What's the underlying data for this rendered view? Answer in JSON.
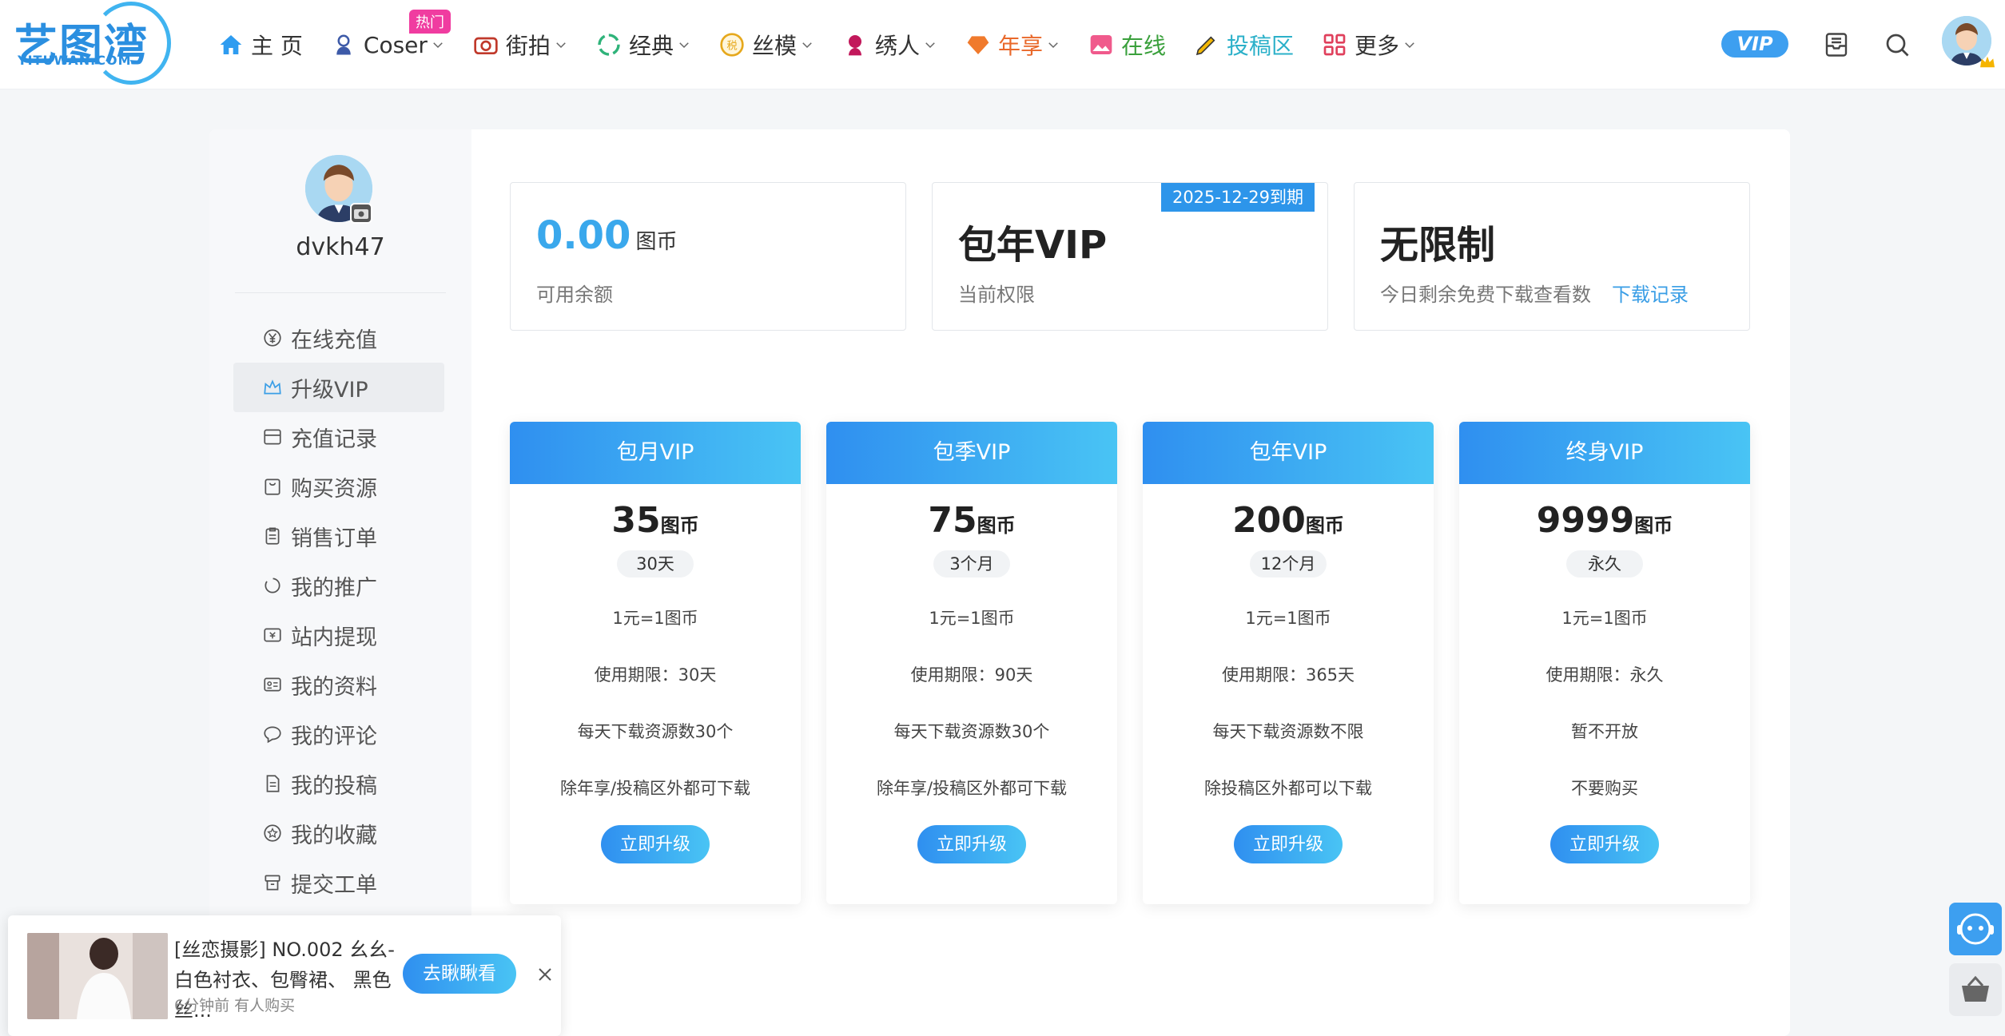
{
  "logo": {
    "text": "艺图湾",
    "sub": "YITUWAN.COM"
  },
  "nav": {
    "items": [
      {
        "label": "主 页",
        "icon": "home-icon"
      },
      {
        "label": "Coser",
        "icon": "coser-icon",
        "dropdown": true
      },
      {
        "label": "街拍",
        "icon": "camera-icon",
        "dropdown": true
      },
      {
        "label": "经典",
        "icon": "recycle-icon",
        "dropdown": true
      },
      {
        "label": "丝模",
        "icon": "stamp-icon",
        "dropdown": true
      },
      {
        "label": "绣人",
        "icon": "woman-icon",
        "dropdown": true
      },
      {
        "label": "年享",
        "icon": "diamond-icon",
        "dropdown": true
      },
      {
        "label": "在线",
        "icon": "image-icon"
      },
      {
        "label": "投稿区",
        "icon": "pen-icon"
      },
      {
        "label": "更多",
        "icon": "grid-icon",
        "dropdown": true
      }
    ],
    "hot_badge": "热门",
    "vip_label": "VIP"
  },
  "user": {
    "name": "dvkh47"
  },
  "sidebar": {
    "items": [
      {
        "label": "在线充值",
        "icon": "yen-icon"
      },
      {
        "label": "升级VIP",
        "icon": "crown-icon",
        "active": true
      },
      {
        "label": "充值记录",
        "icon": "wallet-icon"
      },
      {
        "label": "购买资源",
        "icon": "bag-icon"
      },
      {
        "label": "销售订单",
        "icon": "clipboard-icon"
      },
      {
        "label": "我的推广",
        "icon": "circle-dashed-icon"
      },
      {
        "label": "站内提现",
        "icon": "cash-icon"
      },
      {
        "label": "我的资料",
        "icon": "id-card-icon"
      },
      {
        "label": "我的评论",
        "icon": "comment-icon"
      },
      {
        "label": "我的投稿",
        "icon": "document-icon"
      },
      {
        "label": "我的收藏",
        "icon": "star-icon"
      },
      {
        "label": "提交工单",
        "icon": "ticket-icon"
      }
    ]
  },
  "stats": {
    "balance": {
      "value": "0.00",
      "unit": "图币",
      "label": "可用余额"
    },
    "vip": {
      "value": "包年VIP",
      "label": "当前权限",
      "badge": "2025-12-29到期"
    },
    "downloads": {
      "value": "无限制",
      "label": "今日剩余免费下载查看数",
      "link": "下载记录"
    }
  },
  "plans": [
    {
      "name": "包月VIP",
      "price": "35",
      "unit": "图币",
      "period": "30天",
      "rate": "1元=1图币",
      "term": "使用期限：30天",
      "daily": "每天下载资源数30个",
      "scope": "除年享/投稿区外都可下载",
      "button": "立即升级"
    },
    {
      "name": "包季VIP",
      "price": "75",
      "unit": "图币",
      "period": "3个月",
      "rate": "1元=1图币",
      "term": "使用期限：90天",
      "daily": "每天下载资源数30个",
      "scope": "除年享/投稿区外都可下载",
      "button": "立即升级"
    },
    {
      "name": "包年VIP",
      "price": "200",
      "unit": "图币",
      "period": "12个月",
      "rate": "1元=1图币",
      "term": "使用期限：365天",
      "daily": "每天下载资源数不限",
      "scope": "除投稿区外都可以下载",
      "button": "立即升级"
    },
    {
      "name": "终身VIP",
      "price": "9999",
      "unit": "图币",
      "period": "永久",
      "rate": "1元=1图币",
      "term": "使用期限：永久",
      "daily": "暂不开放",
      "scope": "不要购买",
      "button": "立即升级"
    }
  ],
  "popup": {
    "title": "[丝恋摄影] NO.002 幺幺-白色衬衣、包臀裙、 黑色丝...",
    "meta": "6分钟前 有人购买",
    "button": "去瞅瞅看"
  },
  "colors": {
    "accent": "#2f8ff0",
    "accent_light": "#49c4f4",
    "hot": "#f03ca0",
    "orange": "#e9682a",
    "green": "#3aa03c"
  }
}
